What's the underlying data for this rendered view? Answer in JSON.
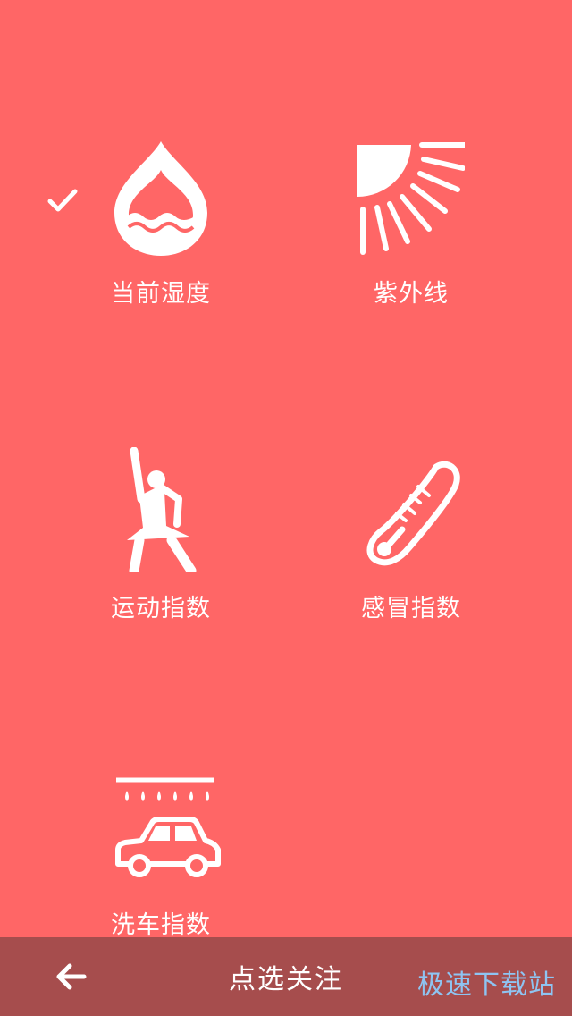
{
  "tiles": [
    {
      "id": "humidity",
      "label": "当前湿度",
      "selected": true
    },
    {
      "id": "uv",
      "label": "紫外线",
      "selected": false
    },
    {
      "id": "sport",
      "label": "运动指数",
      "selected": false
    },
    {
      "id": "cold",
      "label": "感冒指数",
      "selected": false
    },
    {
      "id": "carwash",
      "label": "洗车指数",
      "selected": false
    }
  ],
  "bottom_bar": {
    "title": "点选关注",
    "back_icon": "arrow-left-icon"
  },
  "watermark": "极速下载站",
  "colors": {
    "background": "#FF6666",
    "bottom_bar": "#A64D4D",
    "foreground": "#FFFFFF",
    "watermark": "#8EC4F2"
  }
}
